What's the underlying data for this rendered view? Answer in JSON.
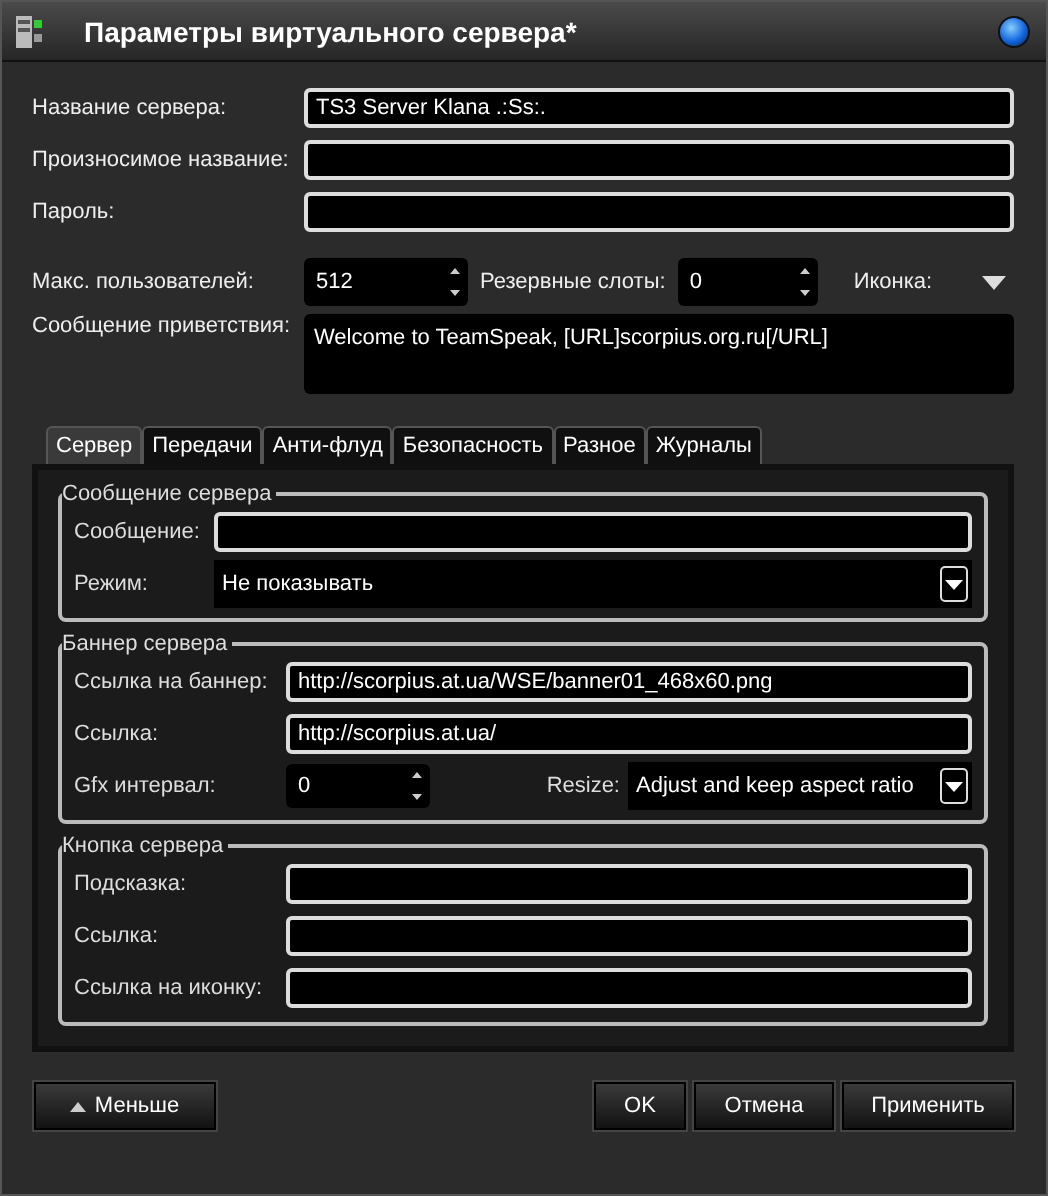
{
  "window": {
    "title": "Параметры виртуального сервера*"
  },
  "fields": [
    {
      "label": "Название сервера:",
      "value": "TS3 Server Klana .:Ss:."
    },
    {
      "label": "Произносимое название:"
    },
    {
      "label": "Пароль:"
    }
  ],
  "limits": {
    "max_users": {
      "label": "Макс. пользователей:",
      "value": "512"
    },
    "reserved": {
      "label": "Резервные слоты:",
      "value": "0"
    },
    "icon": {
      "label": "Иконка:"
    }
  },
  "welcome": {
    "label": "Сообщение приветствия:",
    "value": "Welcome to TeamSpeak, [URL]scorpius.org.ru[/URL]"
  },
  "tabs": [
    {
      "label": "Сервер",
      "selected": true
    },
    {
      "label": "Передачи",
      "selected": false
    },
    {
      "label": "Анти-флуд",
      "selected": false
    },
    {
      "label": "Безопасность",
      "selected": false
    },
    {
      "label": "Разное",
      "selected": false
    },
    {
      "label": "Журналы",
      "selected": false
    }
  ],
  "groups": [
    {
      "title": "Сообщение сервера",
      "rows": [
        {
          "kind": "text",
          "label": "Сообщение:"
        },
        {
          "kind": "select",
          "label": "Режим:",
          "value": "Не показывать"
        }
      ]
    },
    {
      "title": "Баннер сервера",
      "rows": [
        {
          "kind": "text",
          "label": "Ссылка на баннер:",
          "value": "http://scorpius.at.ua/WSE/banner01_468x60.png"
        },
        {
          "kind": "text",
          "label": "Ссылка:",
          "value": "http://scorpius.at.ua/"
        },
        {
          "kind": "spin-select",
          "label": "Gfx интервал:",
          "value": "0",
          "label2": "Resize:",
          "value2": "Adjust and keep aspect ratio"
        }
      ]
    },
    {
      "title": "Кнопка сервера",
      "rows": [
        {
          "kind": "text",
          "label": "Подсказка:"
        },
        {
          "kind": "text",
          "label": "Ссылка:"
        },
        {
          "kind": "text",
          "label": "Ссылка на иконку:"
        }
      ]
    }
  ],
  "footer": {
    "less_button": "Меньше",
    "buttons": [
      "OK",
      "Отмена",
      "Применить"
    ]
  }
}
